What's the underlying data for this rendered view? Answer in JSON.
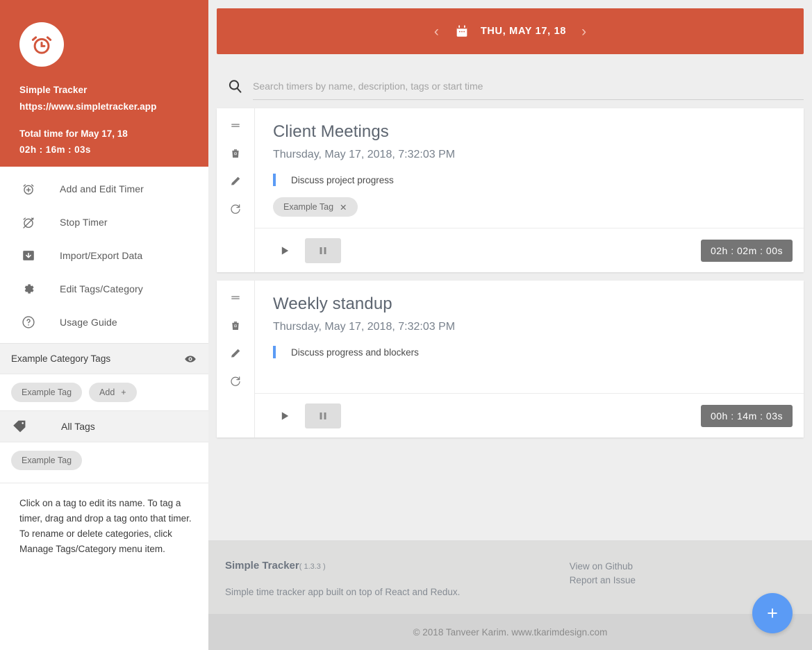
{
  "sidebar": {
    "brand": {
      "logo_icon": "alarm-clock-icon",
      "name": "Simple Tracker",
      "url": "https://www.simpletracker.app",
      "total_label": "Total time for May 17, 18",
      "total_time": "02h : 16m : 03s",
      "background_color": "#d2563c"
    },
    "menu": [
      {
        "icon": "add-timer-icon",
        "label": "Add and Edit Timer"
      },
      {
        "icon": "stop-timer-icon",
        "label": "Stop Timer"
      },
      {
        "icon": "import-export-icon",
        "label": "Import/Export Data"
      },
      {
        "icon": "gear-icon",
        "label": "Edit Tags/Category"
      },
      {
        "icon": "question-circle-icon",
        "label": "Usage Guide"
      }
    ],
    "category": {
      "title": "Example Category Tags",
      "visibility_icon": "eye-icon",
      "tags": [
        "Example Tag"
      ],
      "add_label": "Add"
    },
    "all_tags": {
      "icon": "tag-icon",
      "label": "All Tags",
      "tags": [
        "Example Tag"
      ]
    },
    "hint": "Click on a tag to edit its name. To tag a timer, drag and drop a tag onto that timer. To rename or delete categories, click Manage Tags/Category menu item."
  },
  "main": {
    "datebar": {
      "prev_icon": "chevron-left-icon",
      "calendar_icon": "calendar-icon",
      "date": "THU, MAY 17, 18",
      "next_icon": "chevron-right-icon",
      "background_color": "#d2563c"
    },
    "search": {
      "icon": "search-icon",
      "placeholder": "Search timers by name, description, tags or start time",
      "value": ""
    },
    "timers": [
      {
        "title": "Client Meetings",
        "date": "Thursday, May 17, 2018, 7:32:03 PM",
        "description": "Discuss project progress",
        "tags": [
          "Example Tag"
        ],
        "elapsed": "02h : 02m : 00s",
        "actions": [
          "drag-handle-icon",
          "delete-icon",
          "edit-icon",
          "reset-icon"
        ],
        "play_icon": "play-icon",
        "pause_icon": "pause-icon"
      },
      {
        "title": "Weekly standup",
        "date": "Thursday, May 17, 2018, 7:32:03 PM",
        "description": "Discuss progress and blockers",
        "tags": [],
        "elapsed": "00h : 14m : 03s",
        "actions": [
          "drag-handle-icon",
          "delete-icon",
          "edit-icon",
          "reset-icon"
        ],
        "play_icon": "play-icon",
        "pause_icon": "pause-icon"
      }
    ],
    "footer": {
      "title": "Simple Tracker",
      "version": "( 1.3.3 )",
      "description": "Simple time tracker app built on top of React and Redux.",
      "links": [
        "View on Github",
        "Report an Issue"
      ],
      "copyright": "© 2018 Tanveer Karim. www.tkarimdesign.com"
    },
    "fab": {
      "icon": "plus-icon",
      "color": "#5b9bf5"
    }
  }
}
